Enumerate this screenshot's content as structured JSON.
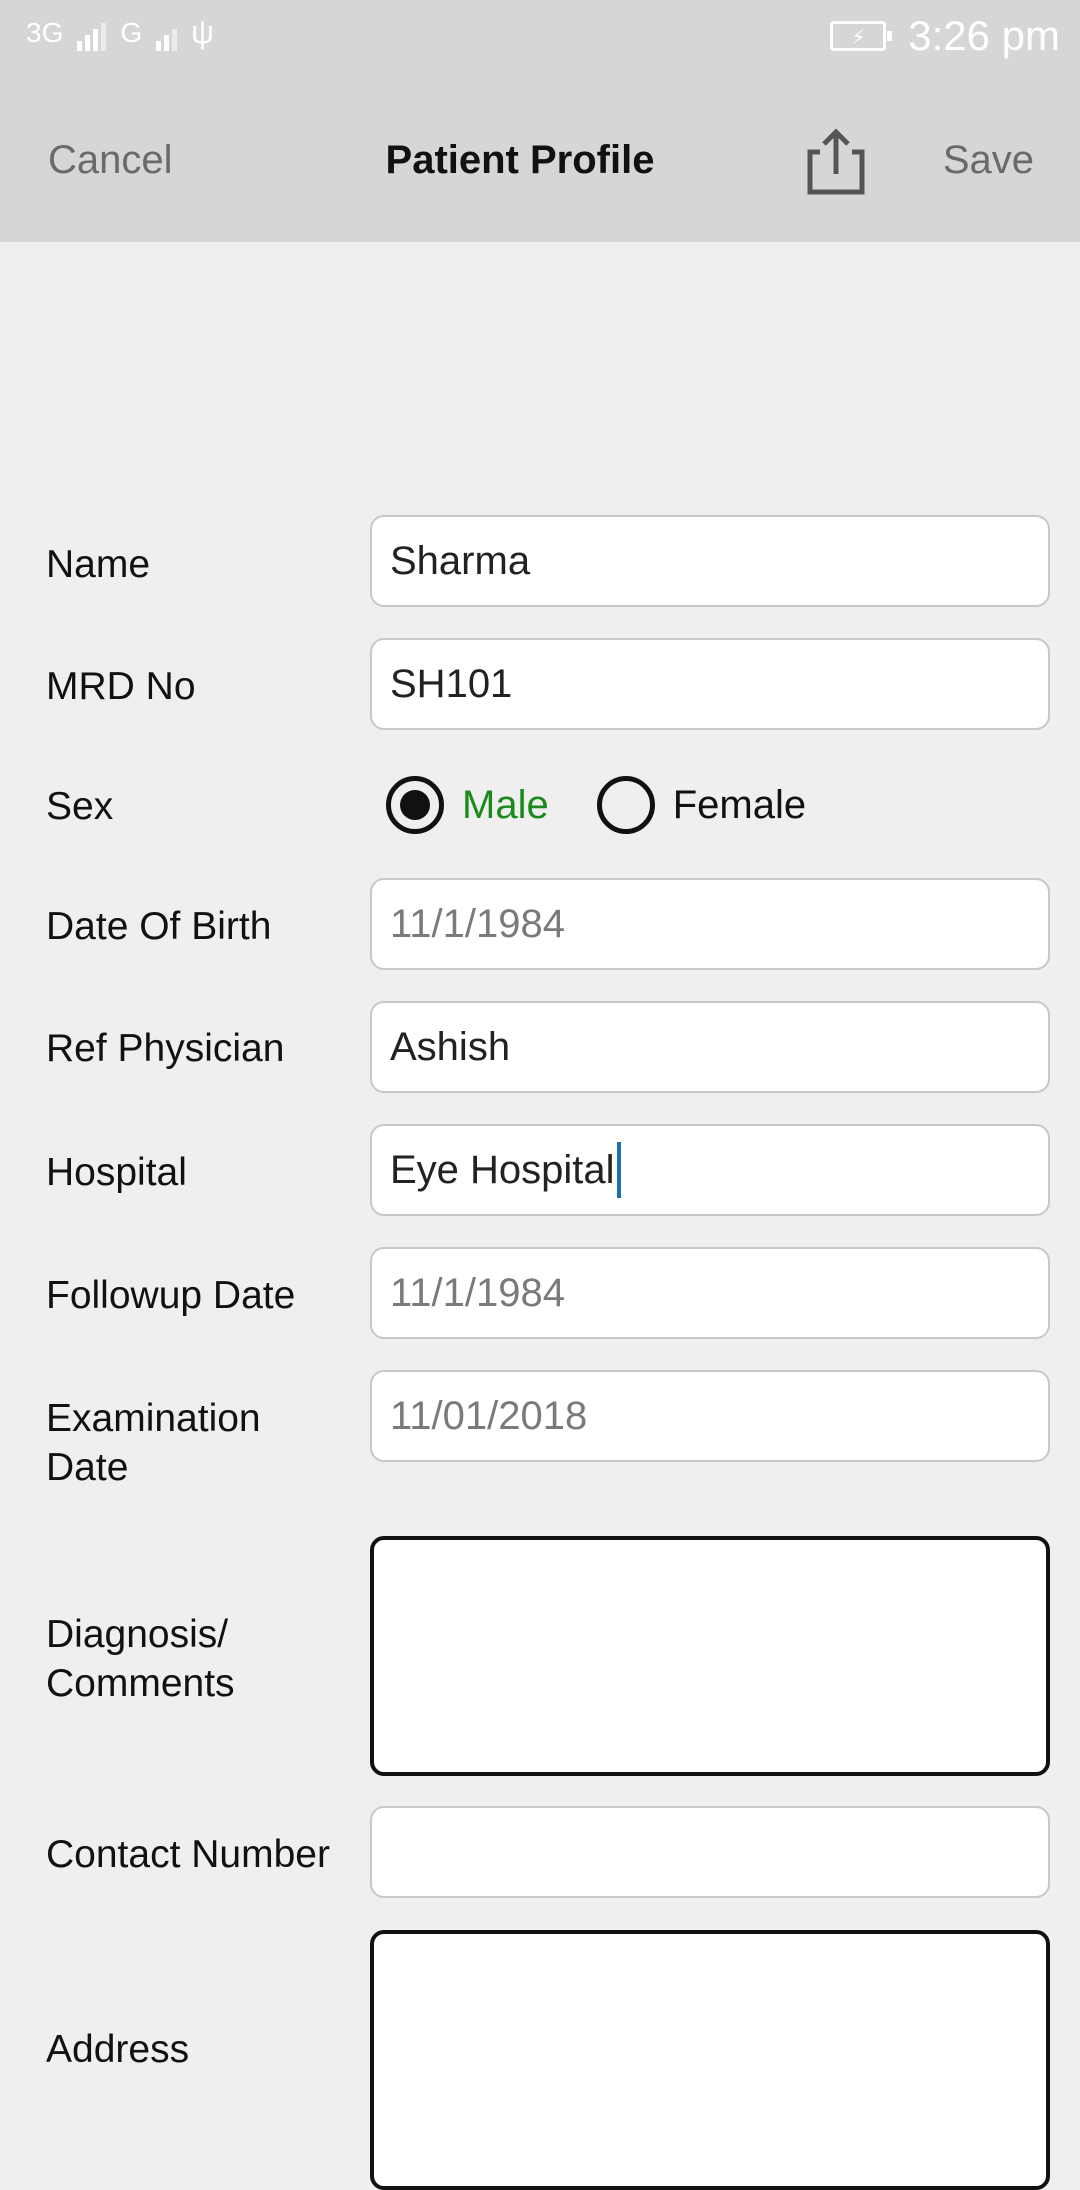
{
  "status_bar": {
    "network_1": "3G",
    "network_2": "G",
    "time": "3:26 pm"
  },
  "toolbar": {
    "cancel_label": "Cancel",
    "title": "Patient Profile",
    "share_icon": "share-icon",
    "save_label": "Save"
  },
  "form": {
    "name": {
      "label": "Name",
      "value": "Sharma"
    },
    "mrd": {
      "label": "MRD No",
      "value": "SH101"
    },
    "sex": {
      "label": "Sex",
      "options": [
        "Male",
        "Female"
      ],
      "selected": "Male",
      "selected_color": "#1a8a1a"
    },
    "dob": {
      "label": "Date Of Birth",
      "placeholder": "11/1/1984"
    },
    "ref_physician": {
      "label": "Ref Physician",
      "value": "Ashish"
    },
    "hospital": {
      "label": "Hospital",
      "value": "Eye Hospital"
    },
    "followup": {
      "label": "Followup Date",
      "placeholder": "11/1/1984"
    },
    "exam_date": {
      "label_line1": "Examination",
      "label_line2": "Date",
      "placeholder": "11/01/2018"
    },
    "diagnosis": {
      "label_line1": "Diagnosis/",
      "label_line2": "Comments",
      "value": ""
    },
    "contact": {
      "label": "Contact Number",
      "value": ""
    },
    "address": {
      "label": "Address",
      "value": ""
    }
  }
}
